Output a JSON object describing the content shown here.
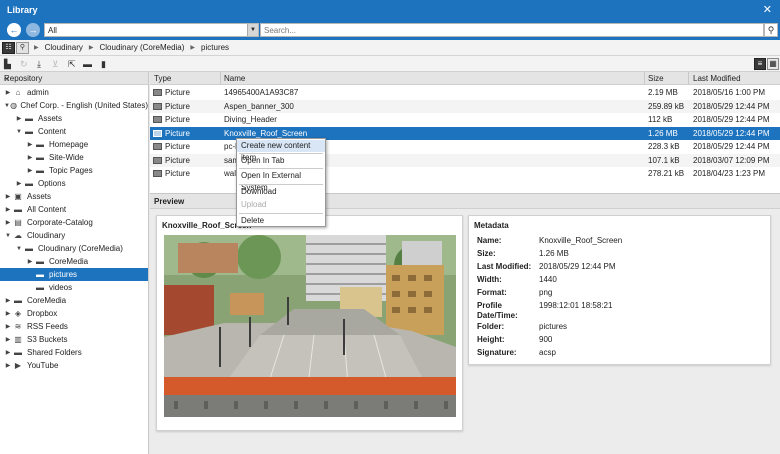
{
  "window": {
    "title": "Library",
    "close_icon": "close-icon"
  },
  "nav": {
    "scope_value": "All",
    "search_placeholder": "Search..."
  },
  "breadcrumb": [
    "Cloudinary",
    "Cloudinary (CoreMedia)",
    "pictures"
  ],
  "left_panel": {
    "title": "Repository",
    "tree": [
      {
        "label": "admin",
        "icon": "home-icon",
        "level": 0,
        "toggle": "collapsed"
      },
      {
        "label": "Chef Corp. - English (United States)",
        "icon": "globe-icon",
        "level": 0,
        "toggle": "expanded"
      },
      {
        "label": "Assets",
        "icon": "folder-icon",
        "level": 1,
        "toggle": "collapsed"
      },
      {
        "label": "Content",
        "icon": "folder-icon",
        "level": 1,
        "toggle": "expanded"
      },
      {
        "label": "Homepage",
        "icon": "folder-icon",
        "level": 2,
        "toggle": "collapsed"
      },
      {
        "label": "Site-Wide",
        "icon": "folder-icon",
        "level": 2,
        "toggle": "collapsed"
      },
      {
        "label": "Topic Pages",
        "icon": "folder-icon",
        "level": 2,
        "toggle": "collapsed"
      },
      {
        "label": "Options",
        "icon": "folder-icon",
        "level": 1,
        "toggle": "collapsed"
      },
      {
        "label": "Assets",
        "icon": "box-icon",
        "level": 0,
        "toggle": "collapsed"
      },
      {
        "label": "All Content",
        "icon": "folder-icon",
        "level": 0,
        "toggle": "collapsed"
      },
      {
        "label": "Corporate-Catalog",
        "icon": "catalog-icon",
        "level": 0,
        "toggle": "collapsed"
      },
      {
        "label": "Cloudinary",
        "icon": "cloud-folder-icon",
        "level": 0,
        "toggle": "expanded"
      },
      {
        "label": "Cloudinary (CoreMedia)",
        "icon": "folder-icon",
        "level": 1,
        "toggle": "expanded"
      },
      {
        "label": "CoreMedia",
        "icon": "folder-icon",
        "level": 2,
        "toggle": "collapsed"
      },
      {
        "label": "pictures",
        "icon": "folder-icon",
        "level": 2,
        "toggle": "none",
        "selected": true
      },
      {
        "label": "videos",
        "icon": "folder-icon",
        "level": 2,
        "toggle": "none"
      },
      {
        "label": "CoreMedia",
        "icon": "folder-icon",
        "level": 0,
        "toggle": "collapsed"
      },
      {
        "label": "Dropbox",
        "icon": "dropbox-icon",
        "level": 0,
        "toggle": "collapsed"
      },
      {
        "label": "RSS Feeds",
        "icon": "rss-icon",
        "level": 0,
        "toggle": "collapsed"
      },
      {
        "label": "S3 Buckets",
        "icon": "bucket-icon",
        "level": 0,
        "toggle": "collapsed"
      },
      {
        "label": "Shared Folders",
        "icon": "folder-icon",
        "level": 0,
        "toggle": "collapsed"
      },
      {
        "label": "YouTube",
        "icon": "youtube-icon",
        "level": 0,
        "toggle": "collapsed"
      }
    ]
  },
  "table": {
    "columns": {
      "type": "Type",
      "name": "Name",
      "size": "Size",
      "modified": "Last Modified"
    },
    "rows": [
      {
        "type": "Picture",
        "name": "14965400A1A93C87",
        "size": "2.19 MB",
        "modified": "2018/05/16 1:00 PM"
      },
      {
        "type": "Picture",
        "name": "Aspen_banner_300",
        "size": "259.89 kB",
        "modified": "2018/05/29 12:44 PM"
      },
      {
        "type": "Picture",
        "name": "Diving_Header",
        "size": "112 kB",
        "modified": "2018/05/29 12:44 PM"
      },
      {
        "type": "Picture",
        "name": "Knoxville_Roof_Screen",
        "size": "1.26 MB",
        "modified": "2018/05/29 12:44 PM",
        "selected": true
      },
      {
        "type": "Picture",
        "name": "pc-h",
        "size": "228.3 kB",
        "modified": "2018/05/29 12:44 PM"
      },
      {
        "type": "Picture",
        "name": "sam",
        "size": "107.1 kB",
        "modified": "2018/03/07 12:09 PM"
      },
      {
        "type": "Picture",
        "name": "wall",
        "size": "278.21 kB",
        "modified": "2018/04/23 1:23 PM"
      }
    ]
  },
  "context_menu": {
    "items": [
      {
        "label": "Create new content item",
        "highlighted": true
      },
      {
        "label": "Open In Tab"
      },
      {
        "label": "Open In External System"
      },
      {
        "label": "Download"
      },
      {
        "label": "Upload",
        "disabled": true
      },
      {
        "label": "Delete"
      }
    ]
  },
  "preview": {
    "title": "Preview",
    "image_title": "Knoxville_Roof_Screen",
    "metadata_title": "Metadata",
    "metadata": [
      {
        "label": "Name:",
        "value": "Knoxville_Roof_Screen"
      },
      {
        "label": "Size:",
        "value": "1.26 MB"
      },
      {
        "label": "Last Modified:",
        "value": "2018/05/29 12:44 PM"
      },
      {
        "label": "Width:",
        "value": "1440"
      },
      {
        "label": "Format:",
        "value": "png"
      },
      {
        "label": "Profile Date/Time:",
        "value": "1998:12:01 18:58:21"
      },
      {
        "label": "Folder:",
        "value": "pictures"
      },
      {
        "label": "Height:",
        "value": "900"
      },
      {
        "label": "Signature:",
        "value": "acsp"
      }
    ]
  },
  "colors": {
    "accent": "#1e73be",
    "selection": "#1e73be",
    "menu_highlight": "#d8e6f5"
  }
}
